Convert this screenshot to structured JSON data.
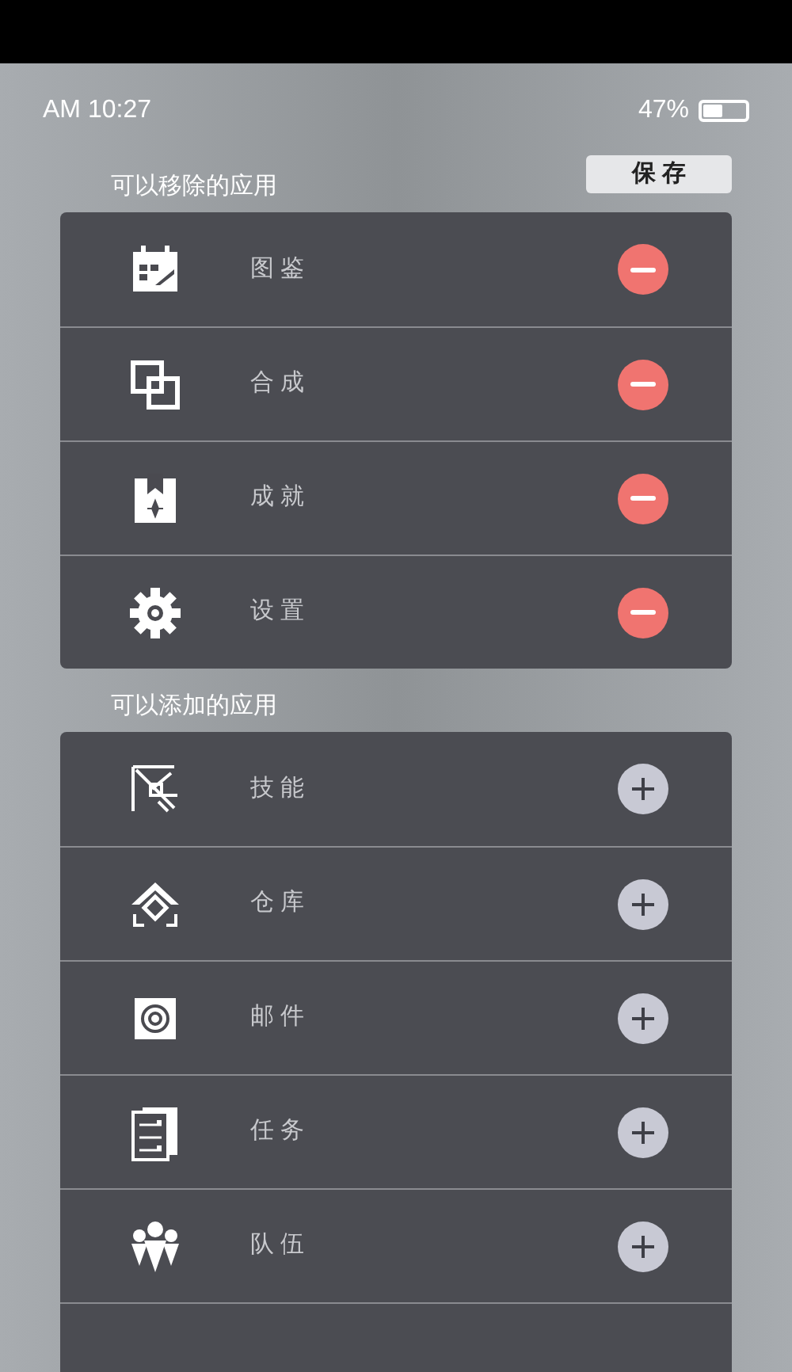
{
  "status_bar": {
    "time": "AM 10:27",
    "battery": "47%"
  },
  "save_button": "保 存",
  "sections": [
    {
      "title": "可以移除的应用",
      "kind": "remove",
      "items": [
        {
          "label": "图 鉴"
        },
        {
          "label": "合 成"
        },
        {
          "label": "成 就"
        },
        {
          "label": "设 置"
        }
      ]
    },
    {
      "title": "可以添加的应用",
      "kind": "add",
      "items": [
        {
          "label": "技 能"
        },
        {
          "label": "仓 库"
        },
        {
          "label": "邮 件"
        },
        {
          "label": "任 务"
        },
        {
          "label": "队 伍"
        }
      ]
    }
  ]
}
